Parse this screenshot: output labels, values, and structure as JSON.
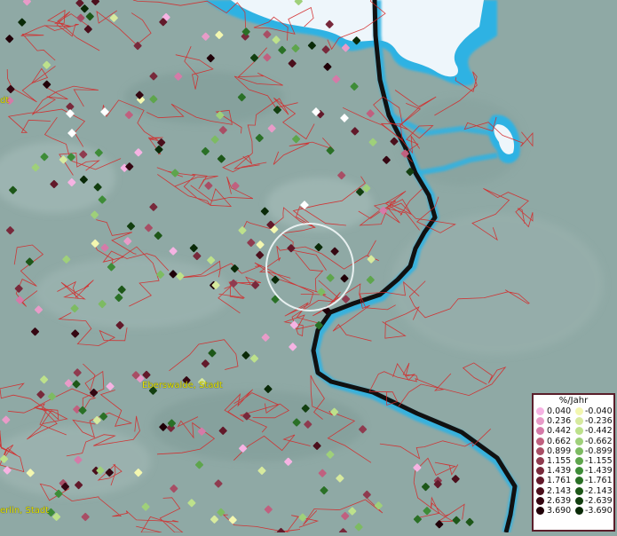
{
  "places": [
    {
      "id": "eberswalde",
      "label": "Eberswalde, Stadt"
    },
    {
      "id": "bernau",
      "label": "erlin, Stadt"
    },
    {
      "id": "top-left",
      "label": "dt"
    }
  ],
  "legend": {
    "title": "%/Jahr",
    "positive": [
      "0.040",
      "0.236",
      "0.442",
      "0.662",
      "0.899",
      "1.155",
      "1.439",
      "1.761",
      "2.143",
      "2.639",
      "3.690"
    ],
    "negative": [
      "-0.040",
      "-0.236",
      "-0.442",
      "-0.662",
      "-0.899",
      "-1.155",
      "-1.439",
      "-1.761",
      "-2.143",
      "-2.639",
      "-3.690"
    ],
    "positive_colors": [
      "#f6b3e3",
      "#e89bc8",
      "#d57aa8",
      "#c0607f",
      "#a84e65",
      "#8f3b4f",
      "#78293b",
      "#62192a",
      "#4b0f1c",
      "#350712",
      "#200008"
    ],
    "negative_colors": [
      "#f3f7b0",
      "#d7ea9e",
      "#bde18b",
      "#9fd07a",
      "#7dbb62",
      "#5ea54c",
      "#3e8c38",
      "#2a7026",
      "#1d5718",
      "#133f10",
      "#0a2a08"
    ]
  },
  "colors": {
    "terrain": "#8fa9a5",
    "boundary": "#d42a2a",
    "river": "#2fb2e3",
    "border_line": "#111111",
    "highlight_circle": "#e8f0f0"
  }
}
